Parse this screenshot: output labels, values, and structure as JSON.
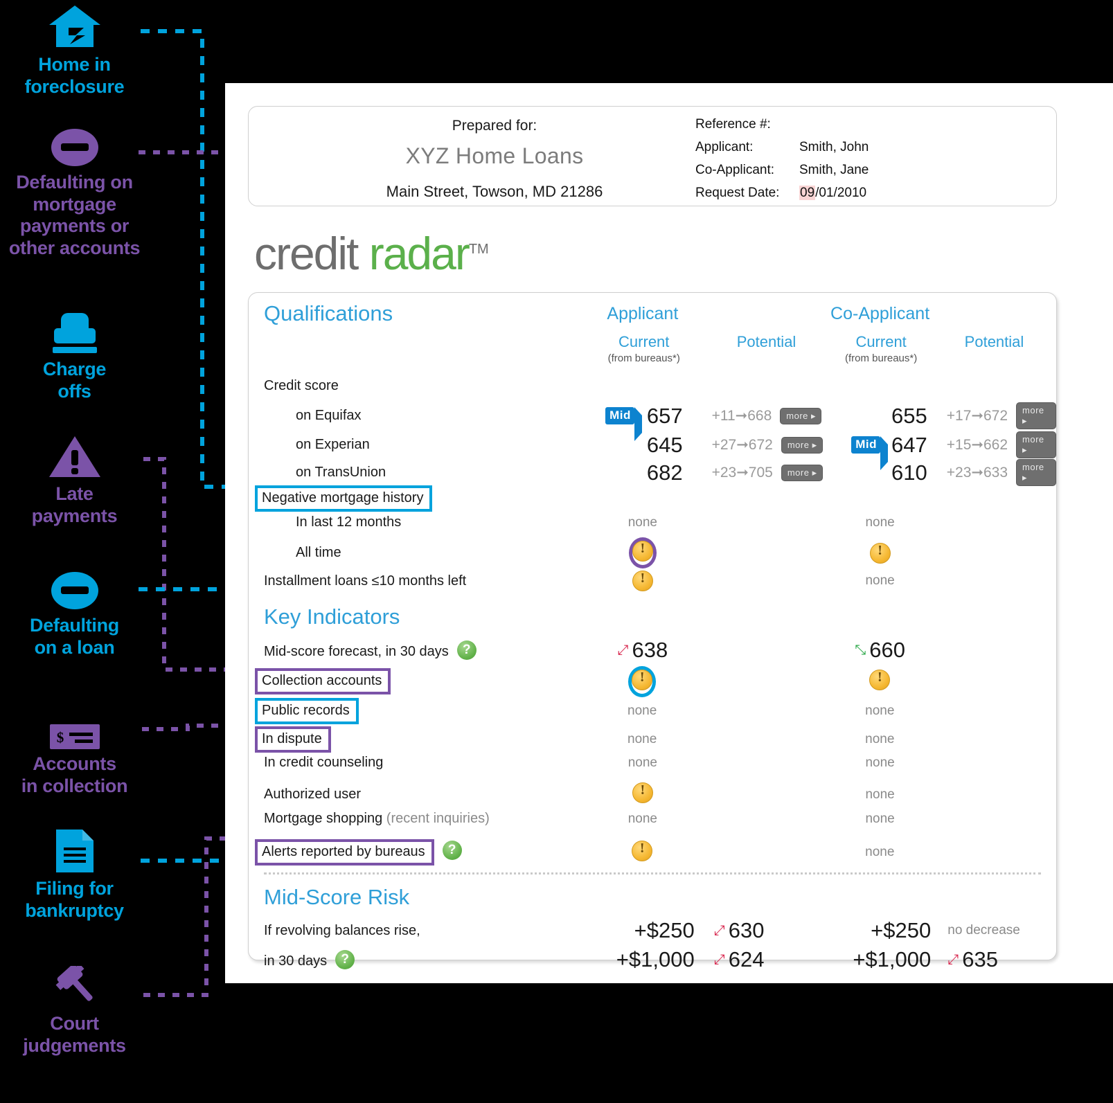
{
  "sidebar": {
    "items": [
      {
        "icon": "house-icon",
        "label": "Home in\nforeclosure",
        "color": "#00a3dd"
      },
      {
        "icon": "no-entry-icon",
        "label": "Defaulting on\nmortgage\npayments or\nother accounts",
        "color": "#7b53a8"
      },
      {
        "icon": "stamp-icon",
        "label": "Charge\noffs",
        "color": "#00a3dd"
      },
      {
        "icon": "warning-triangle-icon",
        "label": "Late\npayments",
        "color": "#7b53a8"
      },
      {
        "icon": "no-entry-icon",
        "label": "Defaulting\non a loan",
        "color": "#00a3dd"
      },
      {
        "icon": "check-dollar-icon",
        "label": "Accounts\nin collection",
        "color": "#7b53a8"
      },
      {
        "icon": "document-icon",
        "label": "Filing for\nbankruptcy",
        "color": "#00a3dd"
      },
      {
        "icon": "gavel-icon",
        "label": "Court\njudgements",
        "color": "#7b53a8"
      }
    ]
  },
  "header": {
    "prepared_for_label": "Prepared for:",
    "company": "XYZ Home Loans",
    "address": "Main Street, Towson, MD 21286",
    "reference_label": "Reference #:",
    "applicant_label": "Applicant:",
    "applicant_name": "Smith, John",
    "coapplicant_label": "Co-Applicant:",
    "coapplicant_name": "Smith, Jane",
    "request_date_label": "Request Date:",
    "request_date_hl": "09",
    "request_date_rest": "/01/2010"
  },
  "logo": {
    "part1": "credit ",
    "part2": "radar",
    "tm": "TM"
  },
  "columns": {
    "applicant": "Applicant",
    "coapplicant": "Co-Applicant",
    "current": "Current",
    "potential": "Potential",
    "from_bureaus": "(from bureaus*)"
  },
  "qualifications": {
    "title": "Qualifications",
    "credit_score_label": "Credit score",
    "bureaus": [
      {
        "label": "on Equifax",
        "a_mid": true,
        "a_current": "657",
        "a_delta": "+11",
        "a_potential": "668",
        "a_more": "more ▸",
        "c_mid": false,
        "c_current": "655",
        "c_delta": "+17",
        "c_potential": "672",
        "c_more": "more ▸"
      },
      {
        "label": "on Experian",
        "a_mid": false,
        "a_current": "645",
        "a_delta": "+27",
        "a_potential": "672",
        "a_more": "more ▸",
        "c_mid": true,
        "c_current": "647",
        "c_delta": "+15",
        "c_potential": "662",
        "c_more": "more ▸"
      },
      {
        "label": "on TransUnion",
        "a_mid": false,
        "a_current": "682",
        "a_delta": "+23",
        "a_potential": "705",
        "a_more": "more ▸",
        "c_mid": false,
        "c_current": "610",
        "c_delta": "+23",
        "c_potential": "633",
        "c_more": "more ▸"
      }
    ],
    "neg_mortgage_label": "Negative mortgage history",
    "neg_rows": [
      {
        "label": "In last 12 months",
        "applicant": "none",
        "coapplicant": "none"
      },
      {
        "label": "All time",
        "applicant": "warning",
        "coapplicant": "warning"
      }
    ],
    "installment_label": "Installment loans ≤10 months left",
    "installment_applicant": "warning",
    "installment_coapplicant": "none"
  },
  "key_indicators": {
    "title": "Key Indicators",
    "rows": [
      {
        "label": "Mid-score forecast, in 30 days",
        "help": true,
        "highlight": "none",
        "applicant": "638",
        "applicant_trend": "down",
        "coapplicant": "660",
        "coapplicant_trend": "up"
      },
      {
        "label": "Collection accounts",
        "help": false,
        "highlight": "purple",
        "applicant": "warning",
        "coapplicant": "warning"
      },
      {
        "label": "Public records",
        "help": false,
        "highlight": "blue",
        "applicant": "none",
        "coapplicant": "none"
      },
      {
        "label": "In dispute",
        "help": false,
        "highlight": "purple",
        "applicant": "none",
        "coapplicant": "none"
      },
      {
        "label": "In credit counseling",
        "help": false,
        "highlight": "none",
        "applicant": "none",
        "coapplicant": "none"
      },
      {
        "label": "Authorized user",
        "help": false,
        "highlight": "none",
        "applicant": "warning",
        "coapplicant": "none"
      },
      {
        "label": "Mortgage shopping ",
        "label_muted": "(recent inquiries)",
        "help": false,
        "highlight": "none",
        "applicant": "none",
        "coapplicant": "none"
      },
      {
        "label": "Alerts reported by bureaus",
        "help": true,
        "highlight": "purple",
        "applicant": "warning",
        "coapplicant": "none"
      }
    ]
  },
  "mid_score_risk": {
    "title": "Mid-Score Risk",
    "line1": "If revolving balances rise,",
    "line2": "in 30 days",
    "rows": [
      {
        "a_amount": "+$250",
        "a_score": "630",
        "a_trend": "down",
        "c_amount": "+$250",
        "c_score": "no decrease",
        "c_trend": "none"
      },
      {
        "a_amount": "+$1,000",
        "a_score": "624",
        "a_trend": "down",
        "c_amount": "+$1,000",
        "c_score": "635",
        "c_trend": "down"
      }
    ]
  },
  "colors": {
    "blue": "#00a3dd",
    "purple": "#7b53a8",
    "green": "#5bb04b",
    "amber": "#f5b731",
    "red": "#d7234b"
  }
}
